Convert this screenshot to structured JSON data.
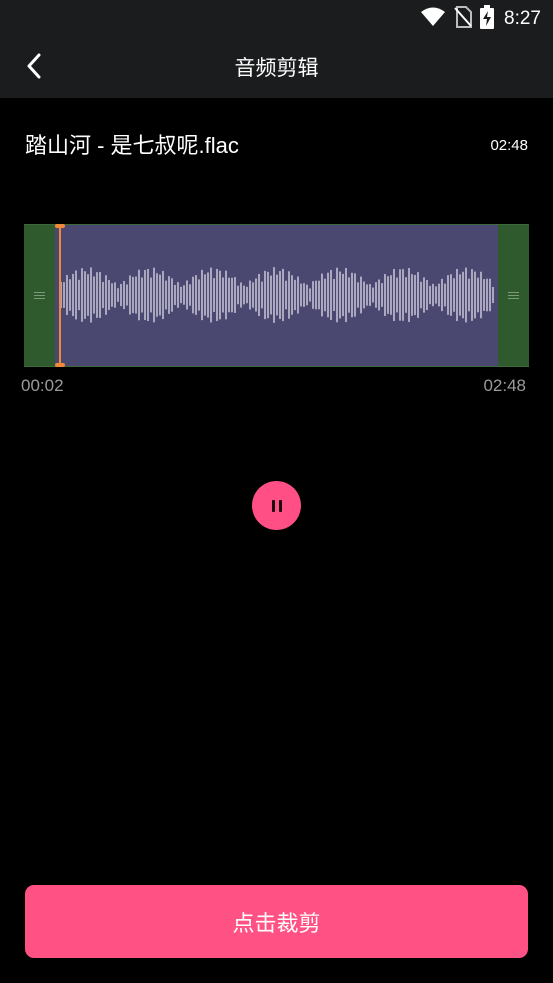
{
  "status_bar": {
    "time": "8:27",
    "icons": [
      "wifi-icon",
      "no-sim-icon",
      "battery-charging-icon"
    ]
  },
  "app_bar": {
    "title": "音频剪辑",
    "back_icon": "back-arrow-icon"
  },
  "file": {
    "name": "踏山河 - 是七叔呢.flac",
    "duration": "02:48"
  },
  "trim": {
    "start_time": "00:02",
    "end_time": "02:48",
    "playhead_position": 0.01
  },
  "player": {
    "state": "playing",
    "icon": "pause-icon"
  },
  "actions": {
    "cut_label": "点击裁剪"
  },
  "colors": {
    "accent": "#ff5183",
    "playhead": "#f0893a",
    "selection": "#4a4870",
    "handle": "#2e5a2e"
  }
}
